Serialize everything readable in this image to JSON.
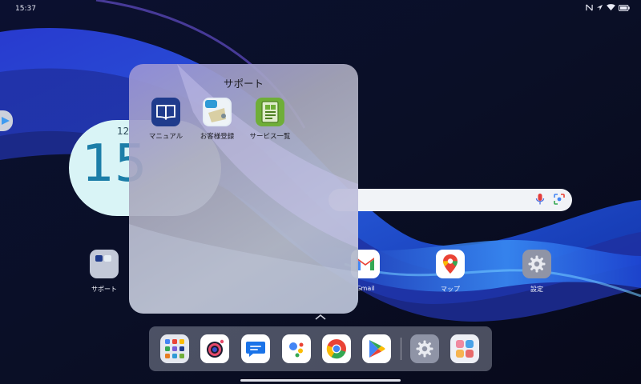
{
  "status_bar": {
    "time": "15:37",
    "icons": [
      "nfc-icon",
      "location-arrow-icon",
      "wifi-icon",
      "battery-icon"
    ]
  },
  "clock_widget": {
    "date_partial": "12",
    "time_partial": "15"
  },
  "home_apps": [
    {
      "name": "support-folder",
      "label": "サポート"
    },
    {
      "name": "gmail",
      "label": "Gmail"
    },
    {
      "name": "maps",
      "label": "マップ"
    },
    {
      "name": "settings",
      "label": "設定"
    }
  ],
  "folder": {
    "title": "サポート",
    "apps": [
      {
        "name": "manual",
        "label": "マニュアル",
        "icon": "book-icon",
        "color": "#1f3b8c"
      },
      {
        "name": "customer-registration",
        "label": "お客様登録",
        "icon": "registration-icon",
        "color": "#e6eef5"
      },
      {
        "name": "service-list",
        "label": "サービス一覧",
        "icon": "service-list-icon",
        "color": "#6fae38"
      }
    ]
  },
  "dock": {
    "apps": [
      {
        "name": "app-drawer",
        "icon": "app-grid-icon"
      },
      {
        "name": "camera",
        "icon": "camera-icon"
      },
      {
        "name": "messages",
        "icon": "messages-icon"
      },
      {
        "name": "assistant",
        "icon": "assistant-icon"
      },
      {
        "name": "chrome",
        "icon": "chrome-icon"
      },
      {
        "name": "play-store",
        "icon": "play-store-icon"
      },
      {
        "name": "settings",
        "icon": "gear-icon"
      },
      {
        "name": "app-library",
        "icon": "app-library-icon"
      }
    ]
  },
  "colors": {
    "accent": "#1c7ea8",
    "folder_text": "#1c1c22"
  }
}
